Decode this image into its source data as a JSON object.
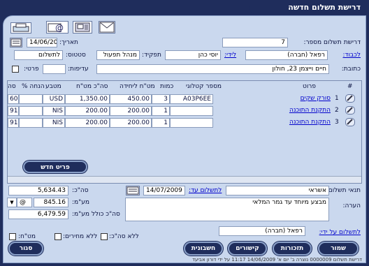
{
  "title": "דרישת תשלום חדשה",
  "header": {
    "number_label": "דרישת תשלום מספר:",
    "number_value": "7",
    "date_label": "תאריך:",
    "date_value": "14/06/2009",
    "to_label": "לכבוד:",
    "to_value": "רפאל (חברה)",
    "by_label": "לידי:",
    "by_value": "יוסי כהן",
    "role_label": "תפקיד:",
    "role_value": "מנהל תפעול",
    "status_label": "סטטוס:",
    "status_value": "לתשלום",
    "address_label": "כתובת:",
    "address_value": "חיים וייצמן 23, חולון",
    "priority_label": "עדיפות:",
    "private_label": "פרטי:"
  },
  "table": {
    "columns": [
      "#",
      "פרוט",
      "מספר קטלוגי",
      "כמות",
      "מט\"ח ליחידה",
      "סה\"כ מט\"ח",
      "מטבע",
      "% הנחה",
      "סה"
    ],
    "rows": [
      {
        "num": "1",
        "desc": "סורק שקים",
        "catalog": "A03P6EE",
        "qty": "3",
        "unit": "450.00",
        "total": "1,350.00",
        "currency": "USD",
        "discount": "",
        "sum": "60"
      },
      {
        "num": "2",
        "desc": "התקנת התוכנה",
        "catalog": "",
        "qty": "1",
        "unit": "200.00",
        "total": "200.00",
        "currency": "NIS",
        "discount": "",
        "sum": "91"
      },
      {
        "num": "3",
        "desc": "התקנת התוכנה",
        "catalog": "",
        "qty": "1",
        "unit": "200.00",
        "total": "200.00",
        "currency": "NIS",
        "discount": "",
        "sum": "91"
      }
    ],
    "new_item_label": "פריט חדש"
  },
  "footer": {
    "payment_terms_label": "תנאי תשלום:",
    "payment_terms_value": "אשראי",
    "pay_until_label": "לתשלום עד:",
    "pay_until_value": "14/07/2009",
    "note_label": "הערה:",
    "note_value": "מבצע מיוחד עד גמר המלאי",
    "total_label": "סה\"כ:",
    "total_value": "5,634.43",
    "vat_label": "מע\"מ:",
    "vat_value": "845.16",
    "vat_symbol": "@",
    "grand_total_label": "סה\"כ כולל מע\"מ:",
    "grand_total_value": "6,479.59",
    "payment_by_label": "לתשלום על ידי:",
    "payment_by_value": "רפאל (חברה)",
    "no_total_label": "ללא סה\"כ:",
    "no_prices_label": "ללא מחירים:",
    "currency_label": "מט\"ח:"
  },
  "buttons": {
    "save": "שמור",
    "reminders": "תזכורות",
    "attachments": "קישורים",
    "invoice": "חשבונית",
    "close": "סגור"
  },
  "status_bar": "דרישת תשלום 0000009 נוצרה ב' יום א' 14/06/2009 11:17 על ידי דורון אביעד",
  "toolbar_icons": [
    "mail-icon",
    "fax-icon",
    "email-at-icon",
    "print-icon"
  ],
  "colors": {
    "frame": "#1f2d5c",
    "panel": "#cad8ee",
    "link": "#0000cc"
  }
}
